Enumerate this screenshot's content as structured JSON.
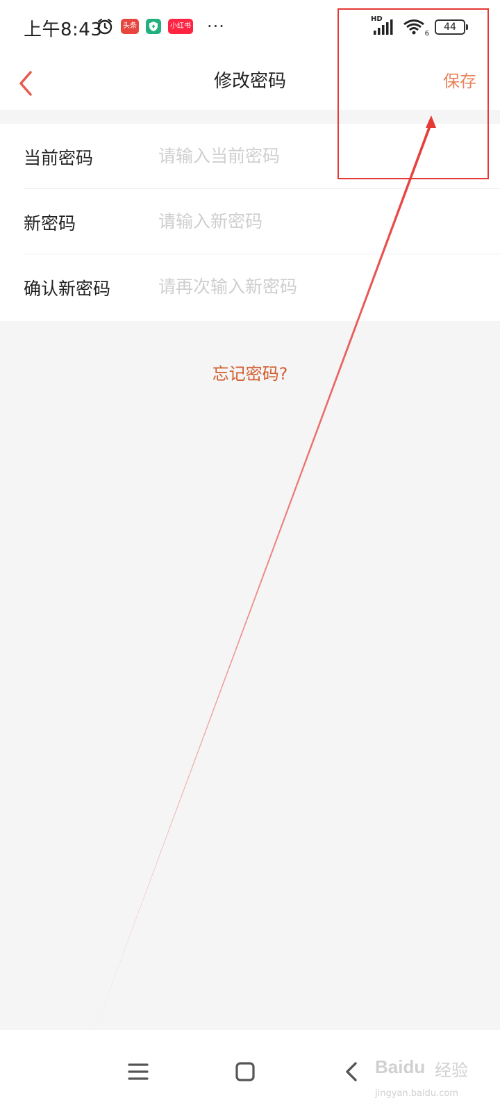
{
  "status_bar": {
    "time": "上午8:43",
    "app_badges": [
      "头条",
      "",
      "小红书"
    ],
    "more": "···",
    "hd": "HD",
    "wifi_sub": "6",
    "battery": "44"
  },
  "header": {
    "title": "修改密码",
    "save_label": "保存"
  },
  "form": {
    "rows": [
      {
        "label": "当前密码",
        "placeholder": "请输入当前密码"
      },
      {
        "label": "新密码",
        "placeholder": "请输入新密码"
      },
      {
        "label": "确认新密码",
        "placeholder": "请再次输入新密码"
      }
    ]
  },
  "forgot_password": "忘记密码?",
  "annotation": {
    "color": "#e53935"
  },
  "colors": {
    "accent": "#e8845a",
    "link": "#d35d2e",
    "back_arrow": "#e85a4f",
    "background": "#f5f5f5"
  },
  "watermark": {
    "logo": "Baidu",
    "brand": "经验",
    "url": "jingyan.baidu.com"
  }
}
